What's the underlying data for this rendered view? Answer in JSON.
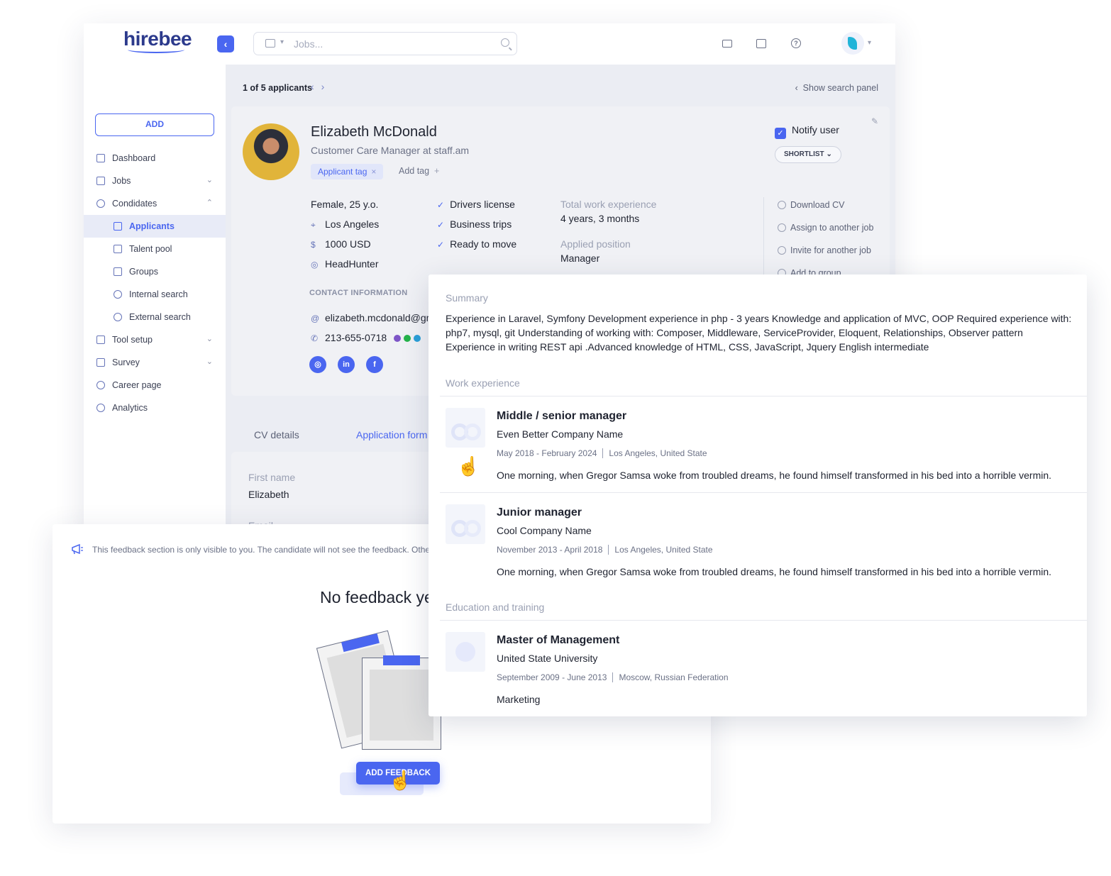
{
  "app": {
    "logo": "hirebee",
    "search_placeholder": "Jobs...",
    "add_label": "ADD"
  },
  "sidebar": {
    "items": [
      {
        "label": "Dashboard"
      },
      {
        "label": "Jobs"
      },
      {
        "label": "Condidates"
      },
      {
        "label": "Applicants"
      },
      {
        "label": "Talent pool"
      },
      {
        "label": "Groups"
      },
      {
        "label": "Internal search"
      },
      {
        "label": "External search"
      },
      {
        "label": "Tool setup"
      },
      {
        "label": "Survey"
      },
      {
        "label": "Career page"
      },
      {
        "label": "Analytics"
      }
    ]
  },
  "pager": {
    "text": "1 of 5 applicants",
    "show_panel": "Show search panel"
  },
  "candidate": {
    "name": "Elizabeth McDonald",
    "role": "Customer Care Manager at staff.am",
    "tag": "Applicant tag",
    "add_tag": "Add tag",
    "notify": "Notify user",
    "shortlist": "SHORTLIST",
    "gender_age": "Female, 25 y.o.",
    "location": "Los Angeles",
    "salary": "1000 USD",
    "source": "HeadHunter",
    "checks": [
      "Drivers license",
      "Business trips",
      "Ready to move"
    ],
    "total_exp_label": "Total work experience",
    "total_exp": "4 years, 3 months",
    "applied_label": "Applied position",
    "applied": "Manager",
    "actions": [
      "Download CV",
      "Assign to another job",
      "Invite for another job",
      "Add to group"
    ],
    "contact_header": "CONTACT INFORMATION",
    "email": "elizabeth.mcdonald@gmail.com",
    "phone": "213-655-0718"
  },
  "tabs": {
    "cv": "CV details",
    "application": "Application form"
  },
  "form": {
    "first_name_label": "First name",
    "first_name": "Elizabeth",
    "email_label": "Email"
  },
  "feedback": {
    "note": "This feedback section is only visible to you. The candidate will not see the feedback. Other",
    "title": "No feedback yet",
    "button": "ADD FEEDBACK"
  },
  "cv": {
    "summary_h": "Summary",
    "summary": "Experience in Laravel, Symfony Development experience in php - 3 years Knowledge and application of MVC, OOP Required experience with: php7, mysql, git Understanding of working with: Composer, Middleware, ServiceProvider, Eloquent, Relationships, Observer pattern Experience in writing REST api .Advanced knowledge of HTML, CSS, JavaScript, Jquery English intermediate",
    "work_h": "Work experience",
    "jobs": [
      {
        "title": "Middle / senior manager",
        "company": "Even Better Company Name",
        "dates": "May 2018 - February 2024",
        "location": "Los Angeles, United State",
        "desc": "One morning, when Gregor Samsa woke from troubled dreams, he found himself transformed in his bed into a horrible vermin."
      },
      {
        "title": "Junior manager",
        "company": "Cool Company Name",
        "dates": "November 2013 - April 2018",
        "location": "Los Angeles, United State",
        "desc": "One morning, when Gregor Samsa woke from troubled dreams, he found himself transformed in his bed into a horrible vermin."
      }
    ],
    "edu_h": "Education and training",
    "education": [
      {
        "title": "Master of Management",
        "school": "United State University",
        "dates": "September 2009 - June 2013",
        "location": "Moscow, Russian Federation",
        "desc": "Marketing"
      }
    ]
  }
}
